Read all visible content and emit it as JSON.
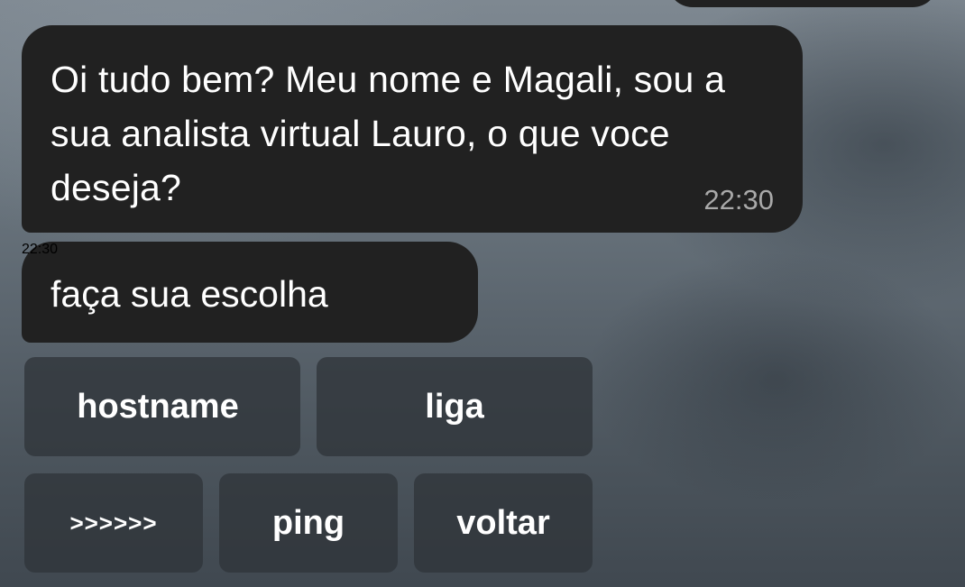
{
  "messages": [
    {
      "text": "Oi tudo bem? Meu nome e Magali, sou a sua analista virtual Lauro, o que voce deseja?",
      "time": "22:30"
    },
    {
      "text": "faça sua escolha",
      "time": "22:30"
    }
  ],
  "keyboard": {
    "row1": [
      "hostname",
      "liga"
    ],
    "row2": [
      ">>>>>>",
      "ping",
      "voltar"
    ]
  },
  "colors": {
    "bubble_bg": "#212121",
    "bubble_text": "#ffffff",
    "time_text": "#a9a9a9",
    "button_bg": "#30343a"
  }
}
